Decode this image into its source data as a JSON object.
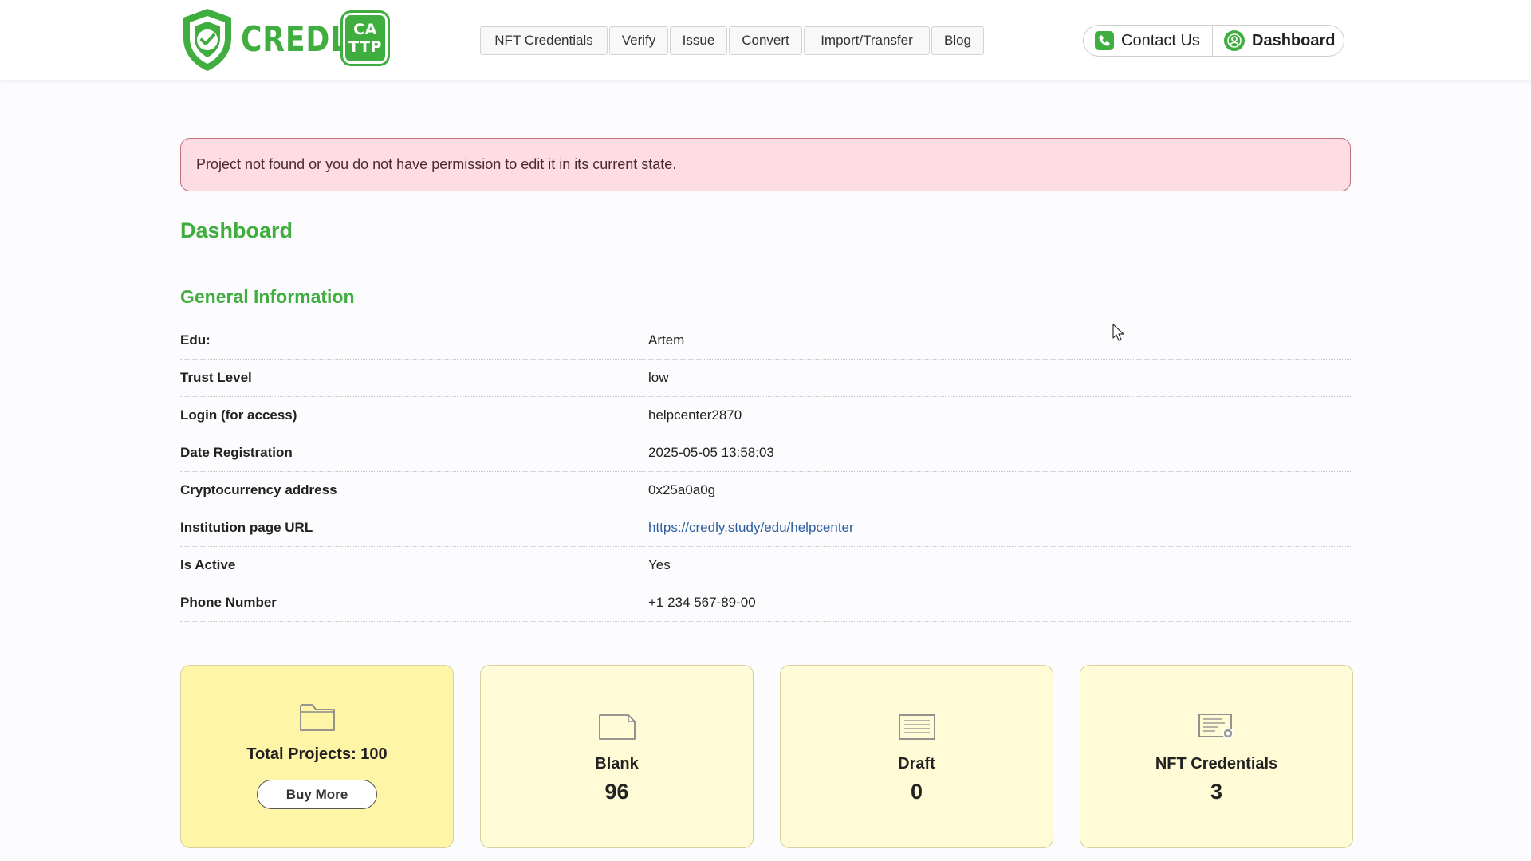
{
  "brand": {
    "name": "CREDLY",
    "badge_line1": "CA",
    "badge_line2": "TTP",
    "color": "#3fae3f"
  },
  "nav": {
    "items": [
      {
        "label": "NFT Credentials"
      },
      {
        "label": "Verify"
      },
      {
        "label": "Issue"
      },
      {
        "label": "Convert"
      },
      {
        "label": "Import/Transfer"
      },
      {
        "label": "Blog"
      }
    ]
  },
  "header_actions": {
    "contact_label": "Contact Us",
    "contact_icon": "phone-icon",
    "dashboard_label": "Dashboard",
    "dashboard_icon": "user-icon"
  },
  "alert": {
    "message": "Project not found or you do not have permission to edit it in its current state.",
    "color": "#fddde3"
  },
  "page": {
    "title": "Dashboard",
    "section_title": "General Information"
  },
  "general_info": {
    "rows": [
      {
        "label": "Edu:",
        "value": "Artem"
      },
      {
        "label": "Trust Level",
        "value": "low"
      },
      {
        "label": "Login (for access)",
        "value": "helpcenter2870"
      },
      {
        "label": "Date Registration",
        "value": "2025-05-05 13:58:03"
      },
      {
        "label": "Cryptocurrency address",
        "value": "0x25a0a0g"
      },
      {
        "label": "Institution page URL",
        "value": "https://credly.study/edu/helpcenter"
      },
      {
        "label": "Is Active",
        "value": "Yes"
      },
      {
        "label": "Phone Number",
        "value": "+1 234 567-89-00"
      }
    ]
  },
  "stats": {
    "total_projects_label": "Total Projects: 100",
    "buy_more_label": "Buy More",
    "cards": [
      {
        "title": "Blank",
        "value": "96",
        "icon": "document-icon"
      },
      {
        "title": "Draft",
        "value": "0",
        "icon": "draft-icon"
      },
      {
        "title": "NFT Credentials",
        "value": "3",
        "icon": "certificate-icon"
      }
    ],
    "total_icon": "folder-icon"
  }
}
